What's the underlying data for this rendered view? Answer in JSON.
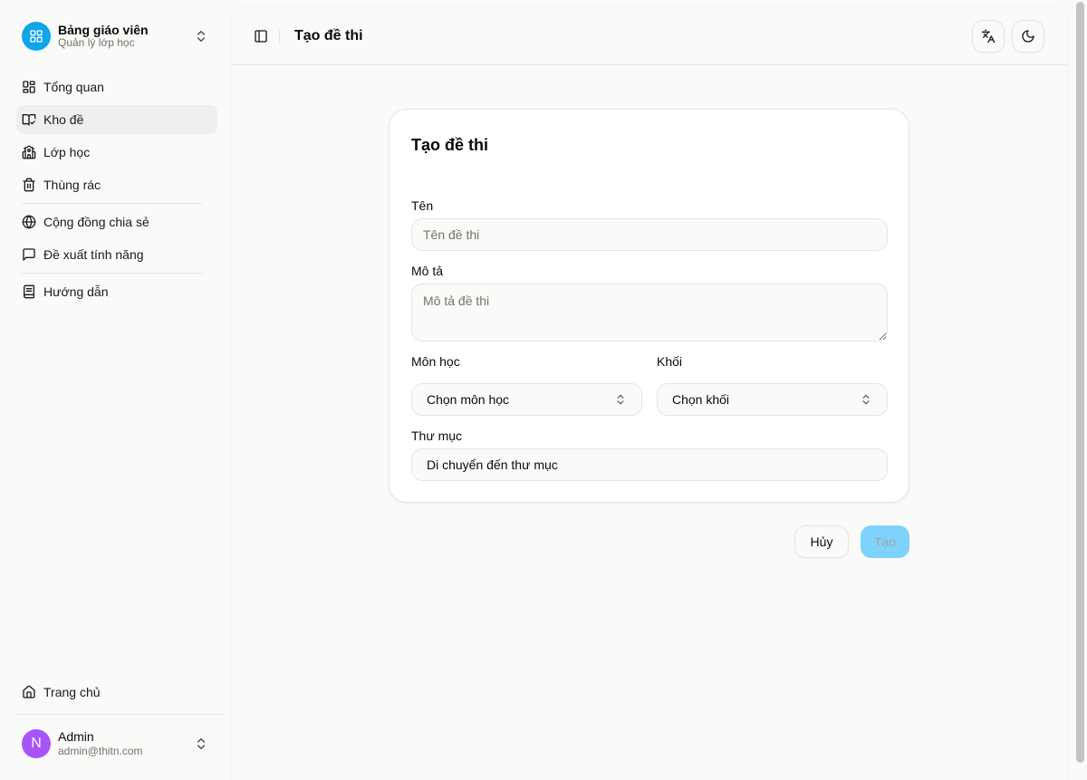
{
  "team": {
    "name": "Bảng giáo viên",
    "subtitle": "Quản lý lớp học"
  },
  "nav": {
    "overview": "Tổng quan",
    "exam_bank": "Kho đề",
    "classes": "Lớp học",
    "trash": "Thùng rác",
    "community": "Cộng đồng chia sẻ",
    "feature_request": "Đề xuất tính năng",
    "guide": "Hướng dẫn",
    "home": "Trang chủ"
  },
  "user": {
    "initial": "N",
    "name": "Admin",
    "email": "admin@thitn.com"
  },
  "header": {
    "title": "Tạo đề thi"
  },
  "form": {
    "title": "Tạo đề thi",
    "name_label": "Tên",
    "name_placeholder": "Tên đề thi",
    "name_value": "",
    "desc_label": "Mô tả",
    "desc_placeholder": "Mô tả đề thi",
    "subject_label": "Môn học",
    "subject_value": "Chọn môn học",
    "grade_label": "Khối",
    "grade_value": "Chọn khối",
    "folder_label": "Thư mục",
    "folder_value": "Di chuyển đến thư mục"
  },
  "actions": {
    "cancel": "Hủy",
    "create": "Tạo"
  },
  "colors": {
    "accent": "#0ea5e9",
    "avatar": "#a855f7",
    "create_disabled": "#7dd3fc",
    "active_nav": "#f0efee"
  },
  "icons": {
    "team_logo": "layout-grid-icon",
    "overview": "layout-dashboard-icon",
    "exam_bank": "book-check-icon",
    "classes": "school-icon",
    "trash": "trash-icon",
    "community": "globe-icon",
    "feature_request": "message-square-icon",
    "guide": "book-icon",
    "home": "house-icon",
    "sidebar_toggle": "panel-left-icon",
    "language": "languages-icon",
    "theme": "moon-icon"
  }
}
